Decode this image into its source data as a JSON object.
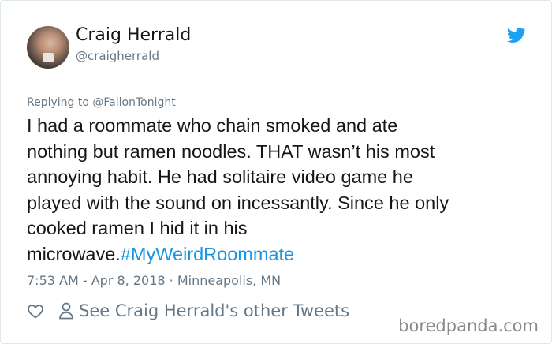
{
  "author": {
    "name": "Craig Herrald",
    "handle": "@craigherrald",
    "avatar_icon": "user-photo"
  },
  "brand": {
    "icon": "twitter-bird-icon",
    "color": "#1da1f2"
  },
  "reply": {
    "prefix": "Replying to ",
    "mention": "@FallonTonight"
  },
  "tweet": {
    "text": "I had a roommate who chain smoked and ate\nnothing but ramen noodles. THAT wasn’t his most\nannoying habit. He had solitaire video game he\nplayed with the sound on incessantly. Since he only\ncooked ramen I hid it in his\nmicrowave.",
    "hashtag": "#MyWeirdRoommate"
  },
  "meta": {
    "time": "7:53 AM",
    "separator1": " - ",
    "date": "Apr 8, 2018",
    "separator2": " · ",
    "location": "Minneapolis, MN"
  },
  "actions": {
    "like_icon": "heart-icon",
    "profile_icon": "person-icon",
    "other_tweets_label": "See Craig Herrald's other Tweets"
  },
  "watermark": "boredpanda.com",
  "colors": {
    "text": "#14171a",
    "secondary": "#657786",
    "link": "#1b95e0"
  }
}
